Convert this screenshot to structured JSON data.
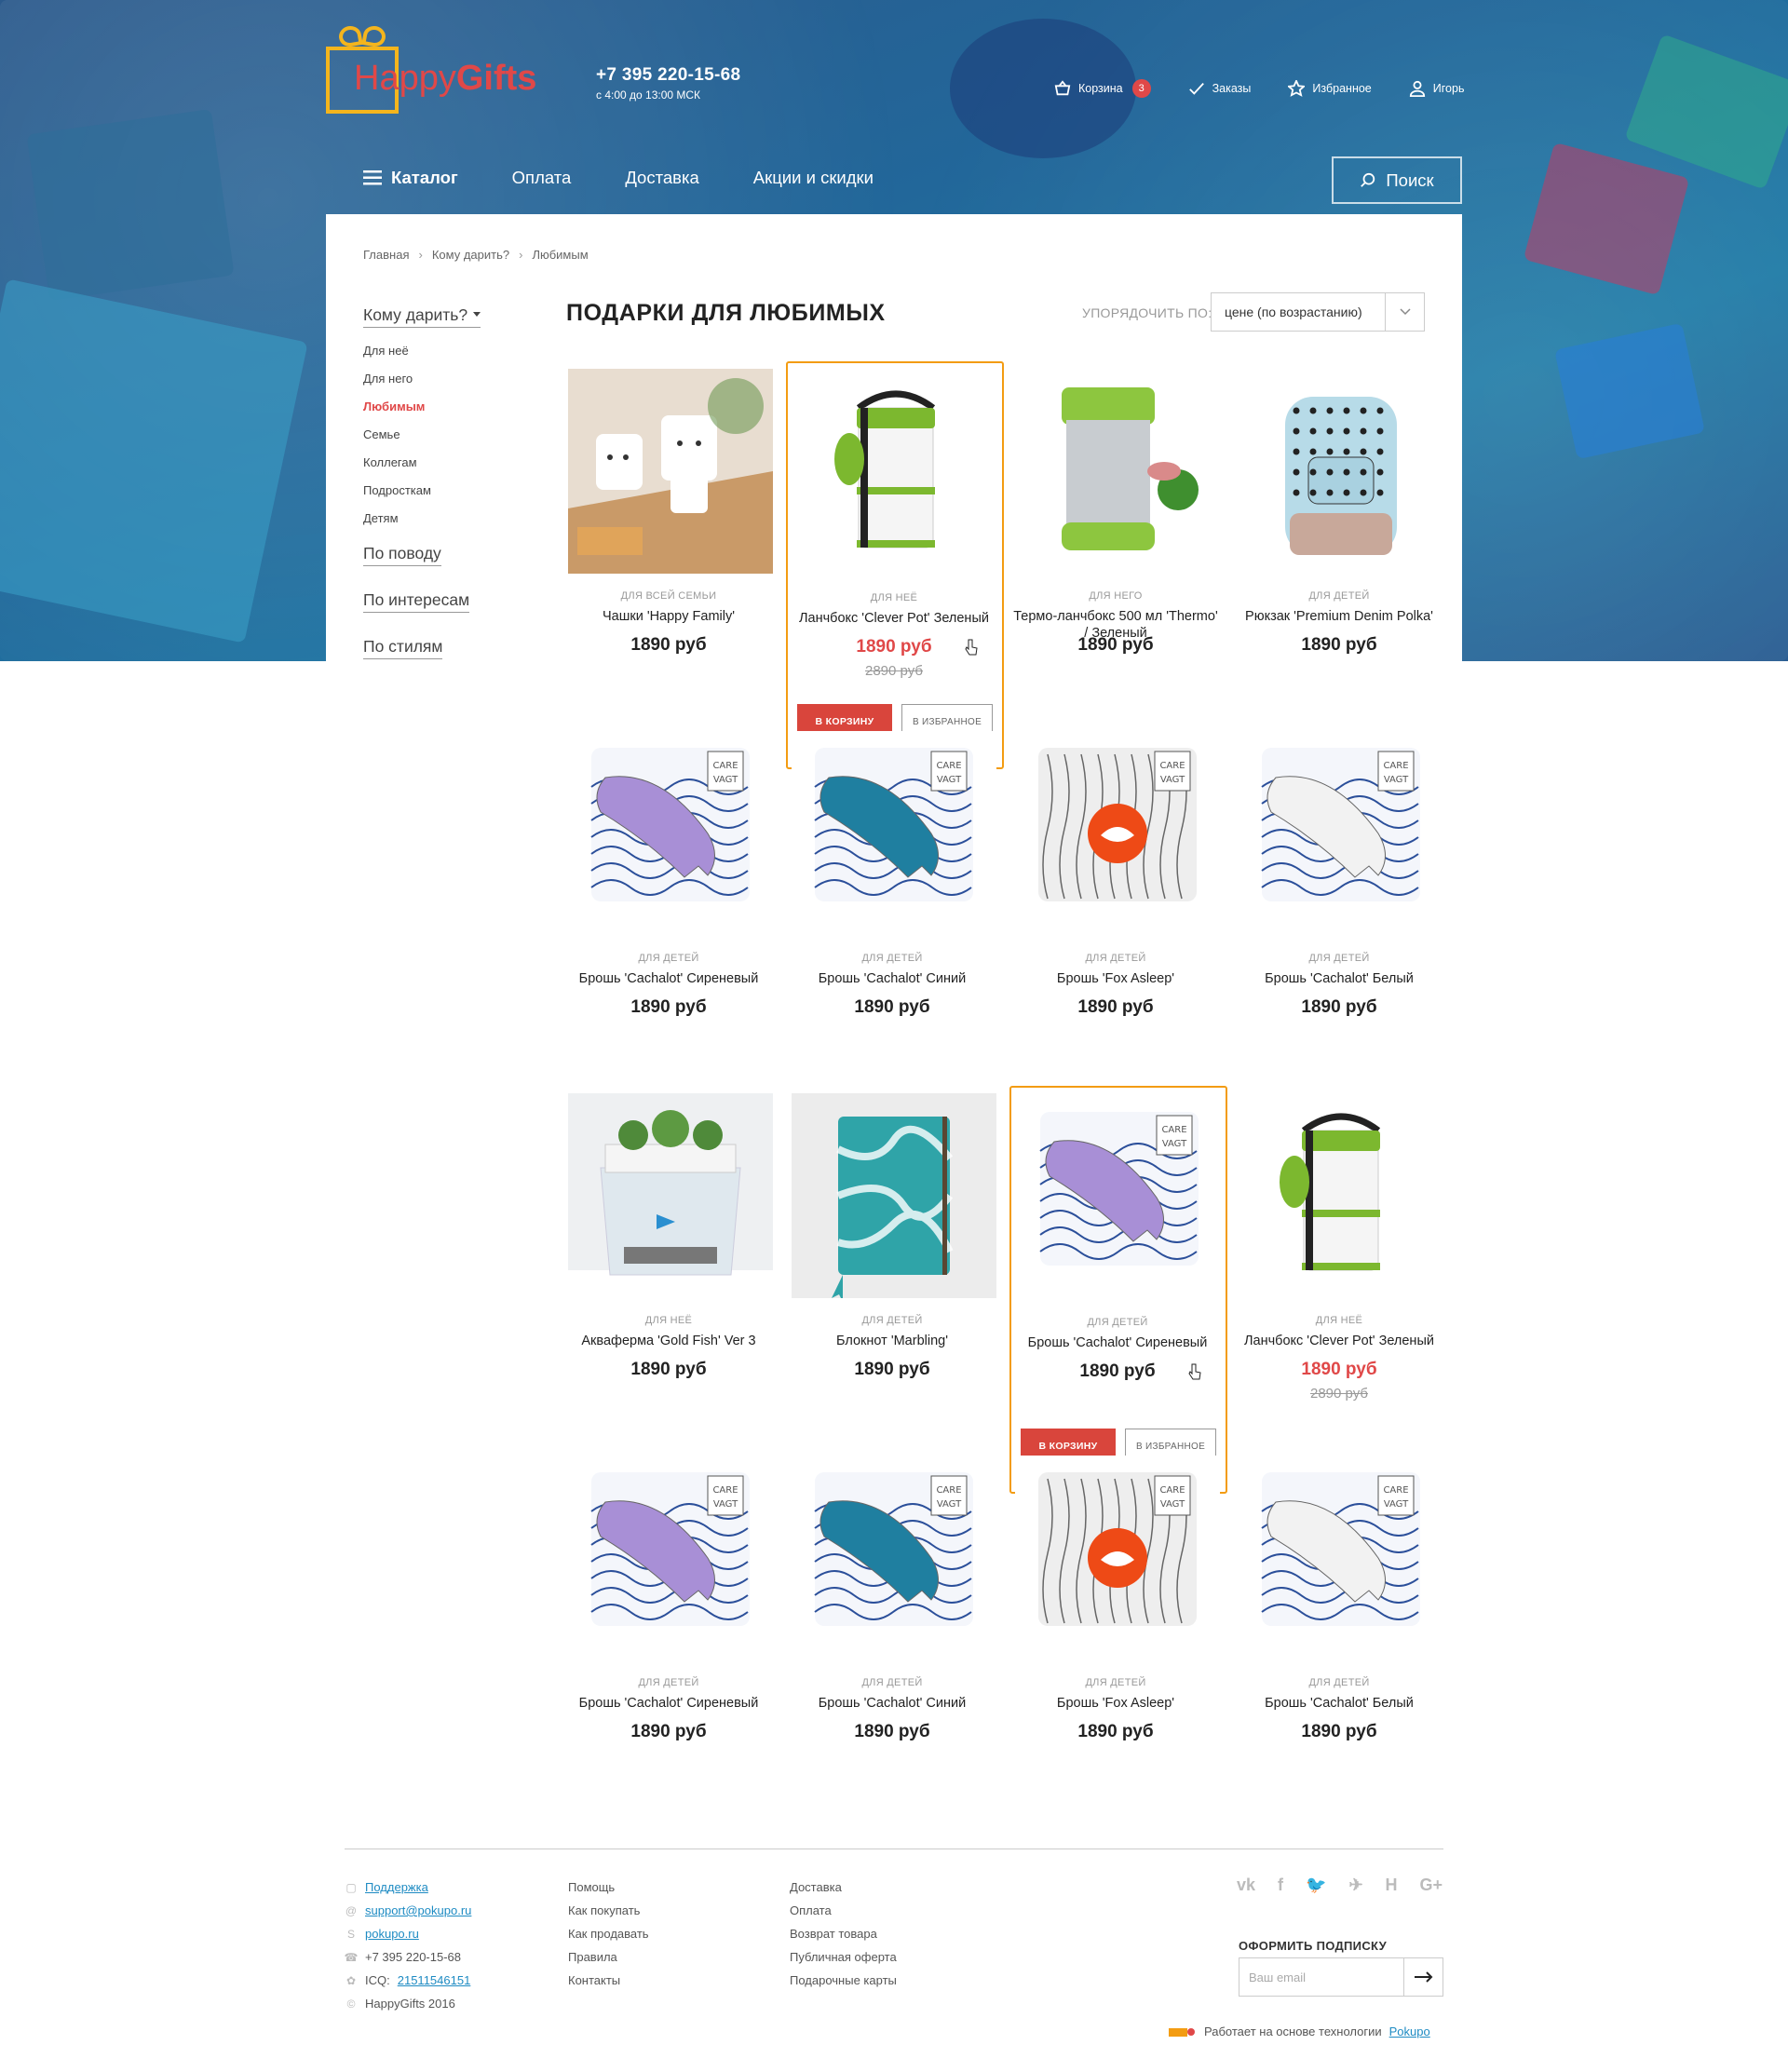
{
  "header": {
    "logo": {
      "part1": "Happy",
      "part2": "Gifts"
    },
    "phone": "+7 395 220-15-68",
    "hours": "с 4:00 до 13:00 МСК",
    "user_nav": {
      "cart_label": "Корзина",
      "cart_count": "3",
      "orders_label": "Заказы",
      "favorites_label": "Избранное",
      "user_label": "Игорь"
    },
    "menu": {
      "catalog": "Каталог",
      "payment": "Оплата",
      "delivery": "Доставка",
      "promo": "Акции и скидки"
    },
    "search_label": "Поиск"
  },
  "breadcrumb": [
    "Главная",
    "Кому дарить?",
    "Любимым"
  ],
  "sidebar": {
    "who_title": "Кому дарить?",
    "who_items": [
      "Для неё",
      "Для него",
      "Любимым",
      "Семье",
      "Коллегам",
      "Подросткам",
      "Детям"
    ],
    "occasion": "По поводу",
    "interests": "По интересам",
    "styles": "По стилям"
  },
  "page_title": "ПОДАРКИ ДЛЯ ЛЮБИМЫХ",
  "sort": {
    "label": "УПОРЯДОЧИТЬ ПО:",
    "value": "цене (по возрастанию)"
  },
  "products": [
    {
      "category": "ДЛЯ ВСЕЙ СЕМЬИ",
      "name": "Чашки 'Happy Family'",
      "price": "1890 руб",
      "old_price": "",
      "image": "cups"
    },
    {
      "category": "ДЛЯ НЕЁ",
      "name": "Ланчбокс 'Clever Pot' Зеленый",
      "price": "1890 руб",
      "old_price": "2890 руб",
      "image": "lunchbox",
      "highlight": true
    },
    {
      "category": "ДЛЯ НЕГО",
      "name": "Термо-ланчбокс 500 мл 'Thermo' / Зеленый",
      "price": "1890 руб",
      "old_price": "",
      "image": "thermo"
    },
    {
      "category": "ДЛЯ ДЕТЕЙ",
      "name": "Рюкзак 'Premium Denim Polka'",
      "price": "1890 руб",
      "old_price": "",
      "image": "backpack"
    },
    {
      "category": "ДЛЯ ДЕТЕЙ",
      "name": "Брошь 'Cachalot' Сиреневый",
      "price": "1890 руб",
      "old_price": "",
      "image": "whale-lilac"
    },
    {
      "category": "ДЛЯ ДЕТЕЙ",
      "name": "Брошь 'Cachalot' Синий",
      "price": "1890 руб",
      "old_price": "",
      "image": "whale-blue"
    },
    {
      "category": "ДЛЯ ДЕТЕЙ",
      "name": "Брошь 'Fox Asleep'",
      "price": "1890 руб",
      "old_price": "",
      "image": "fox"
    },
    {
      "category": "ДЛЯ ДЕТЕЙ",
      "name": "Брошь 'Cachalot' Белый",
      "price": "1890 руб",
      "old_price": "",
      "image": "whale-white"
    },
    {
      "category": "ДЛЯ НЕЁ",
      "name": "Акваферма 'Gold Fish' Ver 3",
      "price": "1890 руб",
      "old_price": "",
      "image": "aquafarm"
    },
    {
      "category": "ДЛЯ ДЕТЕЙ",
      "name": "Блокнот 'Marbling'",
      "price": "1890 руб",
      "old_price": "",
      "image": "notebook"
    },
    {
      "category": "ДЛЯ ДЕТЕЙ",
      "name": "Брошь 'Cachalot' Сиреневый",
      "price": "1890 руб",
      "old_price": "",
      "image": "whale-lilac",
      "highlight": true
    },
    {
      "category": "ДЛЯ НЕЁ",
      "name": "Ланчбокс 'Clever Pot' Зеленый",
      "price": "1890 руб",
      "old_price": "2890 руб",
      "image": "lunchbox"
    },
    {
      "category": "ДЛЯ ДЕТЕЙ",
      "name": "Брошь 'Cachalot' Сиреневый",
      "price": "1890 руб",
      "old_price": "",
      "image": "whale-lilac"
    },
    {
      "category": "ДЛЯ ДЕТЕЙ",
      "name": "Брошь 'Cachalot' Синий",
      "price": "1890 руб",
      "old_price": "",
      "image": "whale-blue"
    },
    {
      "category": "ДЛЯ ДЕТЕЙ",
      "name": "Брошь 'Fox Asleep'",
      "price": "1890 руб",
      "old_price": "",
      "image": "fox"
    },
    {
      "category": "ДЛЯ ДЕТЕЙ",
      "name": "Брошь 'Cachalot' Белый",
      "price": "1890 руб",
      "old_price": "",
      "image": "whale-white"
    }
  ],
  "card_buttons": {
    "cart": "В КОРЗИНУ",
    "favorite": "В ИЗБРАННОЕ"
  },
  "footer": {
    "contacts": [
      {
        "icon": "support-icon",
        "text": "Поддержка",
        "link": true
      },
      {
        "icon": "at-icon",
        "text": "support@pokupo.ru",
        "link": true
      },
      {
        "icon": "skype-icon",
        "text": "pokupo.ru",
        "link": true
      },
      {
        "icon": "phone-icon",
        "text": "+7 395 220-15-68",
        "link": false
      },
      {
        "icon": "icq-icon",
        "prefix": "ICQ:",
        "text": "21511546151",
        "link": true
      },
      {
        "icon": "copyright-icon",
        "text": "HappyGifts 2016",
        "link": false
      }
    ],
    "col2": [
      "Помощь",
      "Как покупать",
      "Как продавать",
      "Правила",
      "Контакты"
    ],
    "col3": [
      "Доставка",
      "Оплата",
      "Возврат товара",
      "Публичная оферта",
      "Подарочные карты"
    ],
    "social": [
      "vk",
      "f",
      "twitter",
      "telegram",
      "H",
      "G+"
    ],
    "subscribe_title": "ОФОРМИТЬ ПОДПИСКУ",
    "subscribe_placeholder": "Ваш email",
    "powered_text": "Работает на основе технологии",
    "powered_link": "Pokupo"
  },
  "colors": {
    "accent": "#e04848",
    "highlight": "#f39c12",
    "link": "#1e8bc3",
    "logo": "#f4b51d"
  }
}
